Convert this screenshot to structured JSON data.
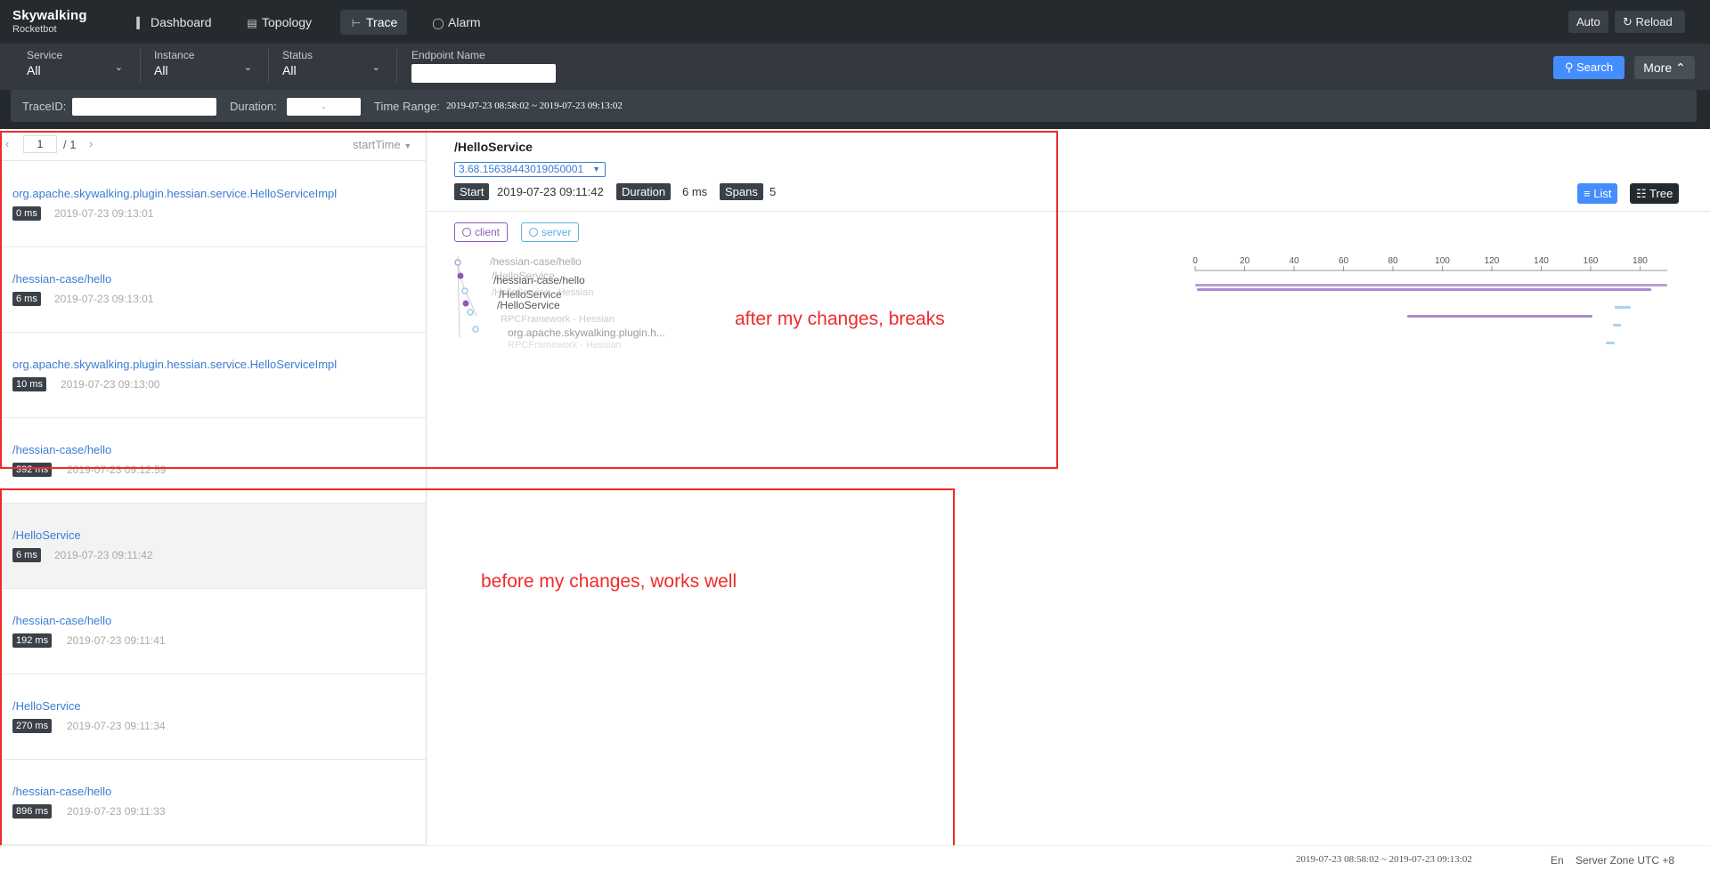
{
  "app": {
    "logo_line1": "Skywalking",
    "logo_line2": "Rocketbot"
  },
  "nav": [
    {
      "label": "Dashboard",
      "icon": "bar-chart-icon"
    },
    {
      "label": "Topology",
      "icon": "topology-icon"
    },
    {
      "label": "Trace",
      "icon": "trace-icon",
      "active": true
    },
    {
      "label": "Alarm",
      "icon": "alarm-icon"
    }
  ],
  "top_buttons": {
    "auto": "Auto",
    "reload": "Reload"
  },
  "filters": {
    "service": {
      "label": "Service",
      "value": "All"
    },
    "instance": {
      "label": "Instance",
      "value": "All"
    },
    "status": {
      "label": "Status",
      "value": "All"
    },
    "endpoint": {
      "label": "Endpoint Name",
      "value": ""
    },
    "search": "Search",
    "more": "More"
  },
  "subbar": {
    "traceid_label": "TraceID:",
    "traceid_value": "",
    "duration_label": "Duration:",
    "duration_value": "-",
    "time_range_label": "Time Range:",
    "time_range_value": "2019-07-23 08:58:02 ~ 2019-07-23 09:13:02"
  },
  "pager": {
    "current": "1",
    "total": "/ 1",
    "sort": "startTime"
  },
  "traces": [
    {
      "name": "org.apache.skywalking.plugin.hessian.service.HelloServiceImpl",
      "duration": "0 ms",
      "time": "2019-07-23 09:13:01"
    },
    {
      "name": "/hessian-case/hello",
      "duration": "6 ms",
      "time": "2019-07-23 09:13:01"
    },
    {
      "name": "org.apache.skywalking.plugin.hessian.service.HelloServiceImpl",
      "duration": "10 ms",
      "time": "2019-07-23 09:13:00"
    },
    {
      "name": "/hessian-case/hello",
      "duration": "392 ms",
      "time": "2019-07-23 09:12:59"
    },
    {
      "name": "/HelloService",
      "duration": "6 ms",
      "time": "2019-07-23 09:11:42",
      "selected": true
    },
    {
      "name": "/hessian-case/hello",
      "duration": "192 ms",
      "time": "2019-07-23 09:11:41"
    },
    {
      "name": "/HelloService",
      "duration": "270 ms",
      "time": "2019-07-23 09:11:34"
    },
    {
      "name": "/hessian-case/hello",
      "duration": "896 ms",
      "time": "2019-07-23 09:11:33"
    }
  ],
  "detail": {
    "title": "/HelloService",
    "trace_id": "3.68.15638443019050001",
    "start_label": "Start",
    "start_value": "2019-07-23 09:11:42",
    "duration_label": "Duration",
    "duration_value": "6 ms",
    "spans_label": "Spans",
    "spans_value": "5",
    "list_btn": "List",
    "tree_btn": "Tree",
    "legend": {
      "client": "client",
      "server": "server"
    },
    "tree_labels": [
      "/hessian-case/hello",
      "/HelloService",
      "/hessian-case/hello",
      "/HelloService - Hessian",
      "/HelloService",
      "/HelloService",
      "RPCFramework - Hessian",
      "org.apache.skywalking.plugin.h...",
      "RPCFramework - Hessian"
    ],
    "axis_ticks": [
      "0",
      "20",
      "40",
      "60",
      "80",
      "100",
      "120",
      "140",
      "160",
      "180"
    ]
  },
  "annotations": {
    "top": "after my changes, breaks",
    "bottom": "before my changes, works well"
  },
  "colors": {
    "client": "#8d59b8",
    "server": "#5ab2e6",
    "annotation": "#f02a2a",
    "accent": "#448dfe"
  },
  "footer": {
    "time_range": "2019-07-23 08:58:02 ~ 2019-07-23 09:13:02",
    "lang": "En",
    "zone": "Server Zone UTC +8"
  }
}
